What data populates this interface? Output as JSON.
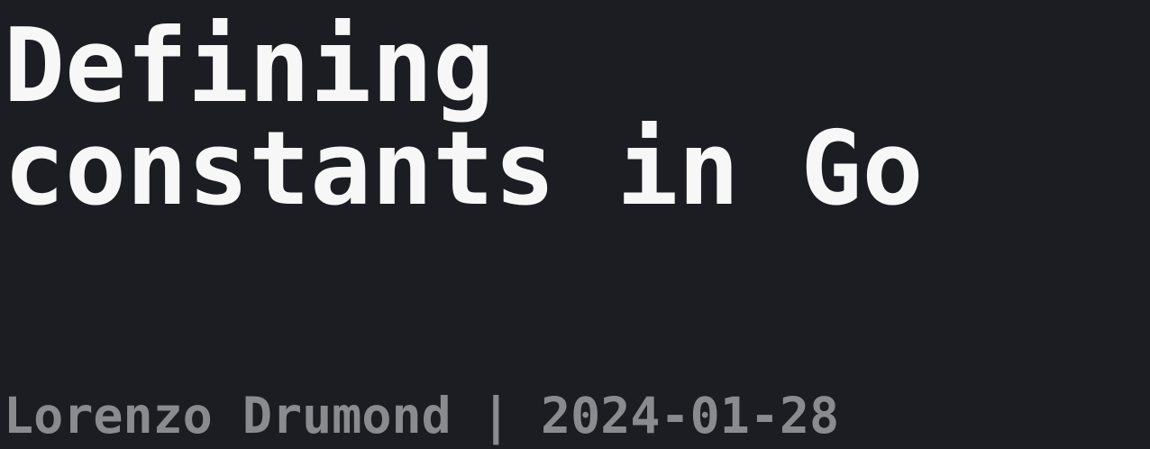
{
  "post": {
    "title_line_1": "Defining",
    "title_line_2": "constants in Go",
    "byline": "Lorenzo Drumond | 2024-01-28"
  },
  "colors": {
    "background": "#1c1d22",
    "title": "#f7f7f7",
    "byline": "#8a8b8f"
  }
}
